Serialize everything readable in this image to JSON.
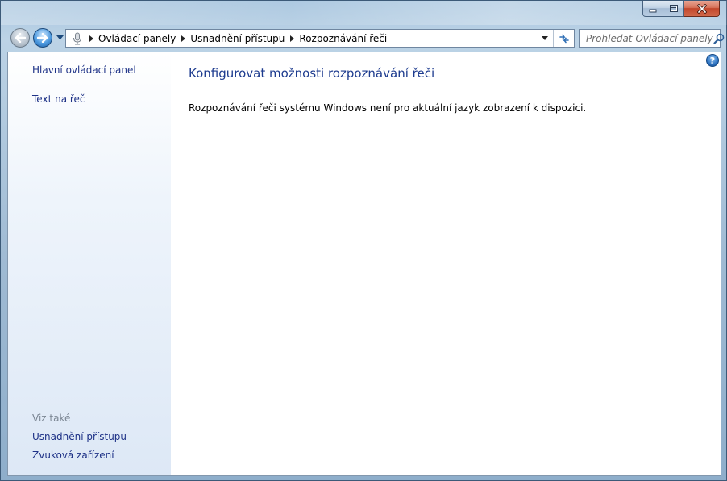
{
  "window": {
    "caption_buttons": [
      "minimize",
      "maximize",
      "close"
    ]
  },
  "nav": {
    "back_icon": "back-arrow-icon",
    "forward_icon": "forward-arrow-icon",
    "breadcrumbs": [
      "Ovládací panely",
      "Usnadnění přístupu",
      "Rozpoznávání řeči"
    ],
    "search_placeholder": "Prohledat Ovládací panely"
  },
  "left_pane": {
    "links": [
      "Hlavní ovládací panel",
      "Text na řeč"
    ],
    "see_also_heading": "Viz také",
    "see_also_links": [
      "Usnadnění přístupu",
      "Zvuková zařízení"
    ]
  },
  "main": {
    "title": "Konfigurovat možnosti rozpoznávání řeči",
    "message": "Rozpoznávání řeči systému Windows není pro aktuální jazyk zobrazení k dispozici."
  },
  "colors": {
    "link": "#1e3287",
    "title": "#1e3c8f",
    "heading_gray": "#7c8794",
    "close_red": "#c2452a"
  }
}
